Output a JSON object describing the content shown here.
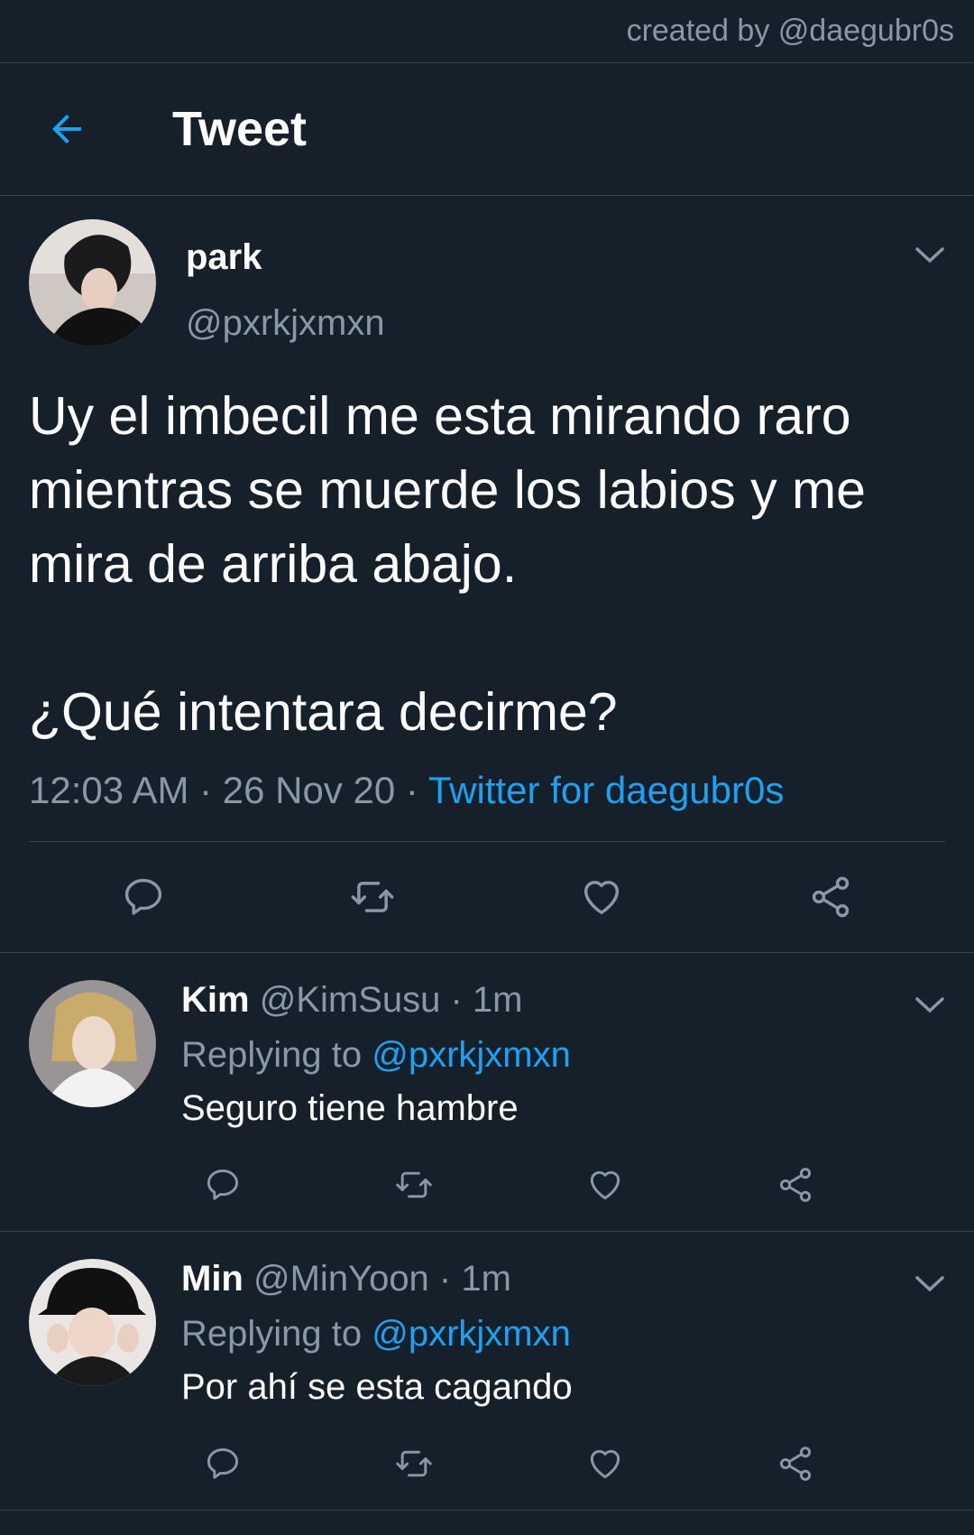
{
  "credit": "created by @daegubr0s",
  "header": {
    "title": "Tweet",
    "back_icon": "arrow-left-icon"
  },
  "tweet": {
    "name": "park",
    "handle": "@pxrkjxmxn",
    "text": "Uy el imbecil me esta mirando raro mientras se muerde los labios y me mira de arriba abajo.\n\n¿Qué intentara decirme?",
    "time": "12:03 AM",
    "sep1": " · ",
    "date": "26 Nov 20",
    "sep2": " · ",
    "source": "Twitter for daegubr0s"
  },
  "replies": [
    {
      "name": "Kim",
      "handle": "@KimSusu",
      "time": "1m",
      "replying_label": "Replying to",
      "replying_to": "@pxrkjxmxn",
      "text": "Seguro tiene hambre"
    },
    {
      "name": "Min",
      "handle": "@MinYoon",
      "time": "1m",
      "replying_label": "Replying to",
      "replying_to": "@pxrkjxmxn",
      "text": "Por ahí se esta cagando"
    }
  ],
  "colors": {
    "background": "#15202b",
    "accent": "#1da1f2",
    "muted": "#8899a6",
    "divider": "#38444d"
  }
}
